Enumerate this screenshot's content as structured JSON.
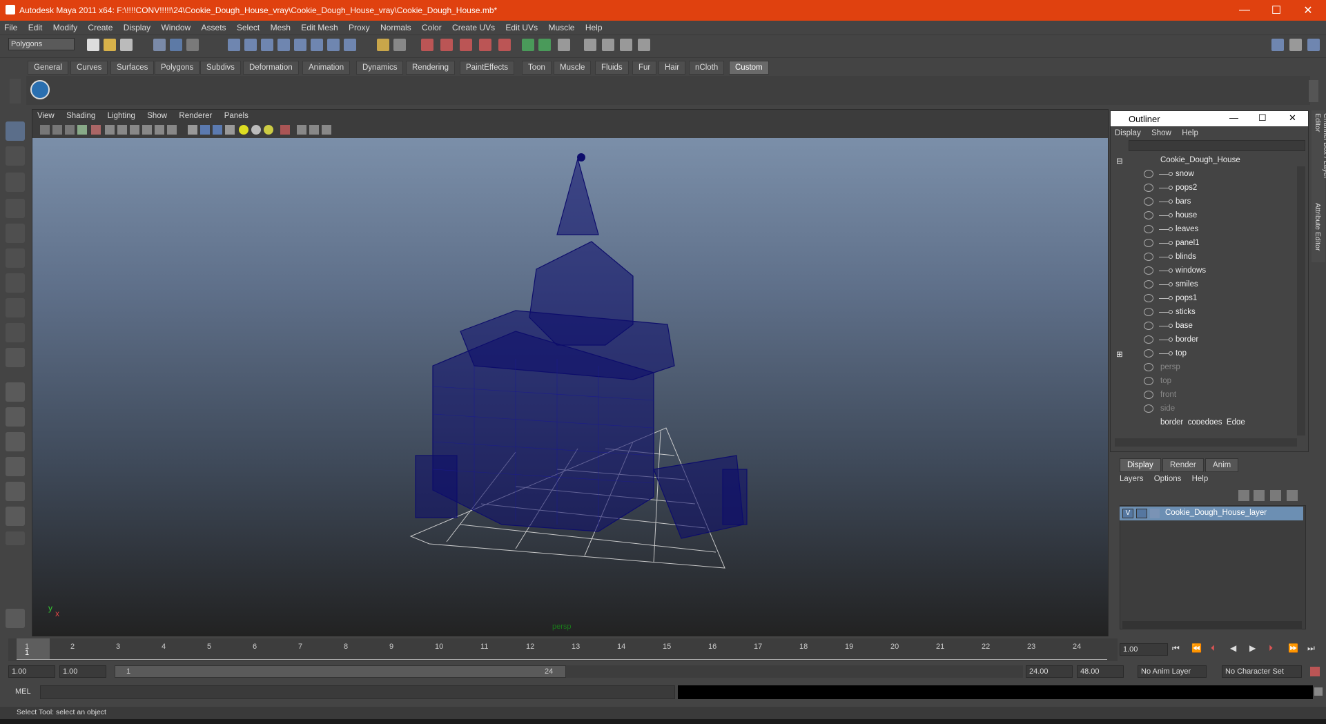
{
  "window": {
    "title": "Autodesk Maya 2011 x64: F:\\!!!!CONV!!!!!\\24\\Cookie_Dough_House_vray\\Cookie_Dough_House_vray\\Cookie_Dough_House.mb*",
    "minimize": "—",
    "maximize": "☐",
    "close": "✕"
  },
  "menubar": [
    "File",
    "Edit",
    "Modify",
    "Create",
    "Display",
    "Window",
    "Assets",
    "Select",
    "Mesh",
    "Edit Mesh",
    "Proxy",
    "Normals",
    "Color",
    "Create UVs",
    "Edit UVs",
    "Muscle",
    "Help"
  ],
  "mode_selector": "Polygons",
  "shelf_tabs": [
    "General",
    "Curves",
    "Surfaces",
    "Polygons",
    "Subdivs",
    "Deformation",
    "Animation",
    "Dynamics",
    "Rendering",
    "PaintEffects",
    "Toon",
    "Muscle",
    "Fluids",
    "Fur",
    "Hair",
    "nCloth",
    "Custom"
  ],
  "active_shelf": "Custom",
  "viewport": {
    "menu": [
      "View",
      "Shading",
      "Lighting",
      "Show",
      "Renderer",
      "Panels"
    ],
    "camera_label": "persp",
    "axis_y": "y",
    "axis_x": "x"
  },
  "outliner": {
    "title": "Outliner",
    "menu": [
      "Display",
      "Show",
      "Help"
    ],
    "root": "Cookie_Dough_House",
    "children": [
      "snow",
      "pops2",
      "bars",
      "house",
      "leaves",
      "panel1",
      "blinds",
      "windows",
      "smiles",
      "pops1",
      "sticks",
      "base",
      "border",
      "top"
    ],
    "cameras": [
      "persp",
      "top",
      "front",
      "side"
    ],
    "last_partial": "border_copedges_Edge"
  },
  "layer_editor": {
    "tabs": [
      "Display",
      "Render",
      "Anim"
    ],
    "active_tab": "Display",
    "menu": [
      "Layers",
      "Options",
      "Help"
    ],
    "layer_visibility": "V",
    "layer_name": "Cookie_Dough_House_layer"
  },
  "side_tabs": [
    "Channel Box / Layer Editor",
    "Attribute Editor"
  ],
  "timeline": {
    "ticks": [
      "1",
      "2",
      "3",
      "4",
      "5",
      "6",
      "7",
      "8",
      "9",
      "10",
      "11",
      "12",
      "13",
      "14",
      "15",
      "16",
      "17",
      "18",
      "19",
      "20",
      "21",
      "22",
      "23",
      "24"
    ],
    "current_frame_marker": "1",
    "current_time": "1.00"
  },
  "range": {
    "start": "1.00",
    "playback_start": "1.00",
    "slider_start": "1",
    "slider_end": "24",
    "playback_end": "24.00",
    "end": "48.00",
    "anim_layer": "No Anim Layer",
    "character_set": "No Character Set"
  },
  "mel": {
    "label": "MEL"
  },
  "help_line": "Select Tool: select an object",
  "colors": {
    "titlebar": "#e0410f",
    "wireframe": "#0d0d6b",
    "layer_highlight": "#6c8fb3"
  }
}
